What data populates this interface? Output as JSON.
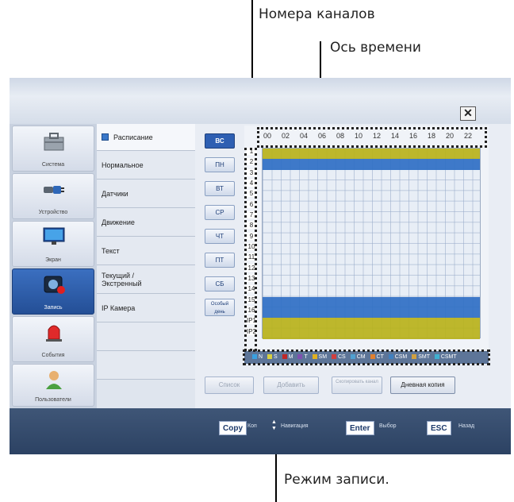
{
  "annotations": {
    "channel_numbers": "Номера каналов",
    "time_axis": "Ось времени",
    "record_mode": "Режим записи."
  },
  "window": {
    "close_label": "✕"
  },
  "sidebar": {
    "items": [
      {
        "label": "Система",
        "icon": "toolbox-icon"
      },
      {
        "label": "Устройство",
        "icon": "plug-icon"
      },
      {
        "label": "Экран",
        "icon": "monitor-icon"
      },
      {
        "label": "Запись",
        "icon": "camera-record-icon",
        "active": true
      },
      {
        "label": "События",
        "icon": "alarm-icon"
      },
      {
        "label": "Пользователи",
        "icon": "user-icon"
      }
    ]
  },
  "submenu": {
    "items": [
      {
        "label": "Расписание",
        "active": true
      },
      {
        "label": "Нормальное"
      },
      {
        "label": "Датчики"
      },
      {
        "label": "Движение"
      },
      {
        "label": "Текст"
      },
      {
        "label": "Текущий / Экстренный"
      },
      {
        "label": "IP Камера"
      }
    ]
  },
  "days": {
    "sun": "ВС",
    "mon": "ПН",
    "tue": "ВТ",
    "wed": "СР",
    "thu": "ЧТ",
    "fri": "ПТ",
    "sat": "СБ",
    "special": "Особый день"
  },
  "schedule": {
    "hours": [
      "00",
      "02",
      "04",
      "06",
      "08",
      "10",
      "12",
      "14",
      "16",
      "18",
      "20",
      "22"
    ],
    "channels": [
      "1",
      "2",
      "3",
      "4",
      "5",
      "6",
      "7",
      "8",
      "9",
      "10",
      "11",
      "12",
      "13",
      "14",
      "15",
      "16",
      "IP1",
      "IP2"
    ],
    "colors": {
      "yellow": "#b8b21a",
      "blue": "#2f6fc4"
    }
  },
  "legend": {
    "items": [
      {
        "label": "N",
        "color": "#3aa0e0"
      },
      {
        "label": "S",
        "color": "#d8d040"
      },
      {
        "label": "M",
        "color": "#c02828"
      },
      {
        "label": "T",
        "color": "#8050b0"
      },
      {
        "label": "SM",
        "color": "#e0b020"
      },
      {
        "label": "CS",
        "color": "#d04040"
      },
      {
        "label": "CM",
        "color": "#50a0d0"
      },
      {
        "label": "CT",
        "color": "#e08030"
      },
      {
        "label": "CSM",
        "color": "#4080c0"
      },
      {
        "label": "SMT",
        "color": "#d0a040"
      },
      {
        "label": "CSMT",
        "color": "#40b0d0"
      }
    ]
  },
  "actions": {
    "list": "Список",
    "add": "Добавить",
    "copy_channel": "Скопировать канал",
    "day_copy": "Дневная копия"
  },
  "footer": {
    "copy_key": "Copy",
    "copy_desc": "Коп",
    "nav_desc": "Навигация",
    "enter_key": "Enter",
    "enter_desc": "Выбор",
    "esc_key": "ESC",
    "esc_desc": "Назад"
  }
}
